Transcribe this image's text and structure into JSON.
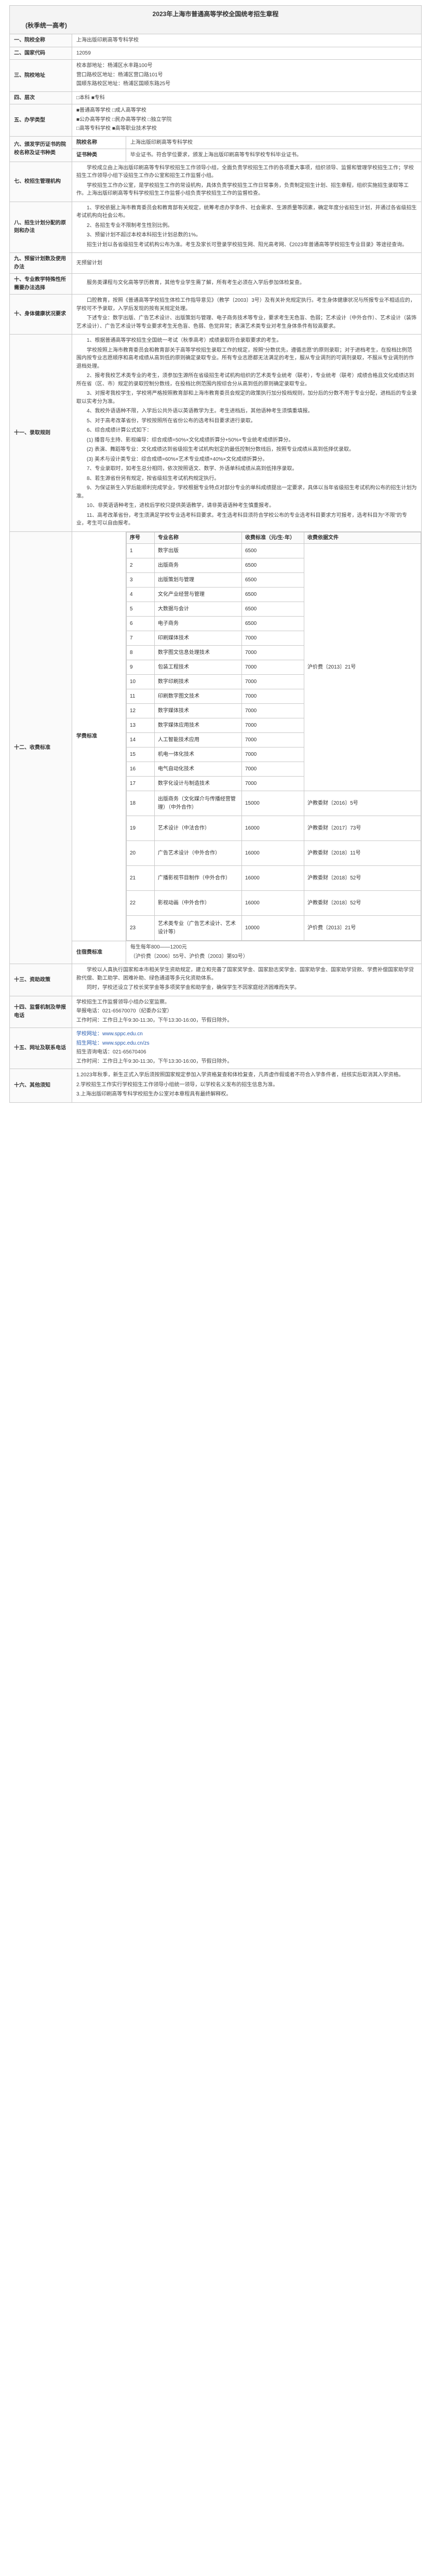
{
  "document": {
    "title": "2023年上海市普通高等学校全国统考招生章程",
    "subtitle": "(秋季统一高考)"
  },
  "sections": {
    "s1": {
      "label": "一、院校全称",
      "text": "上海出版印刷高等专科学校"
    },
    "s2": {
      "label": "二、国家代码",
      "text": "12059"
    },
    "s3": {
      "label": "三、院校地址",
      "lines": [
        "校本部地址：杨浦区水丰路100号",
        "营口路校区地址：杨浦区营口路101号",
        "国顺东路校区地址：杨浦区国顺东路25号"
      ]
    },
    "s4": {
      "label": "四、层次",
      "text": "□本科 ■专科"
    },
    "s5": {
      "label": "五、办学类型",
      "lines": [
        "■普通高等学校 □成人高等学校",
        "■公办高等学校 □民办高等学校 □独立学院",
        "□高等专科学校 ■高等职业技术学校"
      ]
    },
    "s6": {
      "label": "六、颁发学历证书的院校名称及证书种类",
      "rows": [
        {
          "label": "院校名称",
          "text": "上海出版印刷高等专科学校"
        },
        {
          "label": "证书种类",
          "text": "毕业证书。符合学位要求，颁发上海出版印刷高等专科学校专科毕业证书。"
        }
      ]
    },
    "s7": {
      "label": "七、校招生管理机构",
      "paras": [
        "学校成立由上海出版印刷高等专科学校招生工作领导小组，全面负责学校招生工作的各项重大事项，组织领导、监督和管理学校招生工作；学校招生工作领导小组下设招生工作办公室和招生工作监督小组。",
        "学校招生工作办公室，是学校招生工作的常设机构，具体负责学校招生工作日常事务，负责制定招生计划、招生章程，组织实施招生录取等工作。上海出版印刷高等专科学校招生工作监督小组负责学校招生工作的监督检查。"
      ]
    },
    "s8": {
      "label": "八、招生计划分配的原则和办法",
      "paras": [
        "1、学校依据上海市教育委员会和教育部有关规定，统筹考虑办学条件、社会需求、生源质量等因素，确定年度分省招生计划，并通过各省级招生考试机构向社会公布。",
        "2、各招生专业不限制考生性别比例。",
        "3、预留计划不超过本校本科招生计划总数的1%。",
        "招生计划以各省级招生考试机构公布为准。考生及家长可登录学校招生网、阳光高考网、《2023年普通高等学校招生专业目录》等途径查询。"
      ]
    },
    "s9": {
      "label": "九、预留计划数及使用办法",
      "text": "无预留计划"
    },
    "s10": {
      "label": "十、专业教学特殊性所需要办法选择",
      "paras": [
        "服务类课程与文化高等学历教育，其他专业学生需了解，所有考生必须在入学后参加体检复查。"
      ]
    },
    "s11": {
      "label": "十、身体健康状况要求",
      "paras": [
        "口腔教育，按照《普通高等学校招生体检工作指导意见》（教学〔2003〕3号）及有关补充规定执行。考生身体健康状况与所报专业不相适应的，学校可不予录取，入学后发现的按有关规定处理。",
        "下述专业：数字出版、广告艺术设计、出版策划与管理、电子商务技术等专业，要求考生无色盲、色弱；艺术设计（中外合作）、艺术设计（装饰艺术设计）、广告艺术设计等专业要求考生无色盲、色弱、色觉异常；表演艺术类专业对考生身体条件有较高要求。"
      ]
    },
    "s12": {
      "label": "十一、录取规则",
      "paras": [
        "1、根据普通高等学校招生全国统一考试（秋季高考）成绩录取符合录取要求的考生。",
        "学校按照上海市教育委员会和教育部关于高等学校招生录取工作的规定，按照“分数优先，遵循志愿”的原则录取；对于进档考生，在投档比例范围内按专业志愿顺序和高考成绩从高到低的原则确定录取专业。所有专业志愿都无法满足的考生，服从专业调剂的可调剂录取，不服从专业调剂的作退档处理。",
        "2、报考我校艺术类专业的考生，须参加生源所在省级招生考试机构组织的艺术类专业统考（联考），专业统考（联考）成绩合格且文化成绩达到所在省（区、市）规定的录取控制分数线，在投档比例范围内按综合分从高到低的原则确定录取专业。",
        "3、对报考我校学生，学校将严格按照教育部和上海市教育委员会规定的政策执行加分投档规则，加分后的分数不用于专业分配，进档后的专业录取以实考分为准。",
        "4、我校外语语种不限，入学后公共外语以英语教学为主。考生进档后，其他语种考生须慎重填报。",
        "5、对于高考改革省份，学校按照所在省份公布的选考科目要求进行录取。",
        "6、综合成绩计算公式如下：",
        "(1) 播音与主持、影视编导：综合成绩=50%×文化成绩折算分+50%×专业统考成绩折算分。",
        "(2) 表演、舞蹈等专业：文化成绩达到省级招生考试机构划定的最低控制分数线后，按照专业成绩从高到低择优录取。",
        "(3) 美术与设计类专业：综合成绩=60%×艺术专业成绩+40%×文化成绩折算分。",
        "7、专业录取时，如考生总分相同，依次按照语文、数学、外语单科成绩从高到低排序录取。",
        "8、若生源省份另有规定，按省级招生考试机构规定执行。",
        "9、为保证新生入学后能顺利完成学业，学校根据专业特点对部分专业的单科成绩提出一定要求，具体以当年省级招生考试机构公布的招生计划为准。",
        "10、非英语语种考生，进校后学校只提供英语教学，请非英语语种考生慎重报考。",
        "11、高考改革省份，考生须满足学校专业选考科目要求。考生选考科目须符合学校公布的专业选考科目要求方可报考，选考科目为“不限”的专业，考生可以自由报考。"
      ]
    },
    "s13": {
      "label": "十二、收费标准",
      "tuition_label": "学费标准",
      "headers": [
        "序号",
        "专业名称",
        "收费标准（元/生·年）",
        "收费依据文件"
      ],
      "fees": [
        {
          "idx": "1",
          "major": "数字出版",
          "fee": "6500"
        },
        {
          "idx": "2",
          "major": "出版商务",
          "fee": "6500"
        },
        {
          "idx": "3",
          "major": "出版策划与管理",
          "fee": "6500"
        },
        {
          "idx": "4",
          "major": "文化产业经营与管理",
          "fee": "6500"
        },
        {
          "idx": "5",
          "major": "大数据与会计",
          "fee": "6500"
        },
        {
          "idx": "6",
          "major": "电子商务",
          "fee": "6500"
        },
        {
          "idx": "7",
          "major": "印刷媒体技术",
          "fee": "7000"
        },
        {
          "idx": "8",
          "major": "数字图文信息处理技术",
          "fee": "7000"
        },
        {
          "idx": "9",
          "major": "包装工程技术",
          "fee": "7000"
        },
        {
          "idx": "10",
          "major": "数字印刷技术",
          "fee": "7000"
        },
        {
          "idx": "11",
          "major": "印刷数字图文技术",
          "fee": "7000"
        },
        {
          "idx": "12",
          "major": "数字媒体技术",
          "fee": "7000"
        },
        {
          "idx": "13",
          "major": "数字媒体应用技术",
          "fee": "7000"
        },
        {
          "idx": "14",
          "major": "人工智能技术应用",
          "fee": "7000"
        },
        {
          "idx": "15",
          "major": "机电一体化技术",
          "fee": "7000"
        },
        {
          "idx": "16",
          "major": "电气自动化技术",
          "fee": "7000"
        },
        {
          "idx": "17",
          "major": "数字化设计与制造技术",
          "fee": "7000"
        },
        {
          "idx": "18",
          "major": "出版商务（文化媒介与传播经营管理）（中外合作）",
          "fee": "15000"
        },
        {
          "idx": "19",
          "major": "艺术设计（中法合作）",
          "fee": "16000"
        },
        {
          "idx": "20",
          "major": "广告艺术设计（中外合作）",
          "fee": "16000"
        },
        {
          "idx": "21",
          "major": "广播影视节目制作（中外合作）",
          "fee": "16000"
        },
        {
          "idx": "22",
          "major": "影视动画（中外合作）",
          "fee": "16000"
        },
        {
          "idx": "23",
          "major": "艺术类专业（广告艺术设计、艺术设计等）",
          "fee": "10000"
        }
      ],
      "fee_docs": [
        {
          "rows": 17,
          "text": "沪价费〔2013〕21号"
        },
        {
          "rows": 1,
          "text": "沪教委财〔2016〕5号"
        },
        {
          "rows": 1,
          "text": "沪教委财〔2017〕73号"
        },
        {
          "rows": 1,
          "text": "沪教委财〔2018〕11号"
        },
        {
          "rows": 1,
          "text": "沪教委财〔2018〕52号"
        },
        {
          "rows": 1,
          "text": "沪教委财〔2018〕52号"
        },
        {
          "rows": 1,
          "text": "沪价费〔2013〕21号"
        }
      ],
      "dorm_label": "住宿费标准",
      "dorm_lines": [
        "每生每年800——1200元",
        "（沪价费〔2006〕55号、沪价费〔2003〕第93号）"
      ]
    },
    "s14": {
      "label": "十三、资助政策",
      "paras": [
        "学校以人真执行国家和本市相关学生资助规定，建立和完善了国家奖学金、国家励志奖学金、国家助学金、国家助学贷款、学费补偿国家助学贷款代偿、勤工助学、困难补助、绿色通道等多元化资助体系。",
        "同时，学校还设立了校长奖学金等多项奖学金和助学金，确保学生不因家庭经济困难而失学。"
      ]
    },
    "s15": {
      "label": "十四、监督机制及举报电话",
      "lines": [
        "学校招生工作监督领导小组办公室监察。",
        "举报电话：021-65670070（纪委办公室）",
        "工作时间：工作日上午9:30-11:30，下午13:30-16:00，节假日除外。"
      ]
    },
    "s16": {
      "label": "十五、网址及联系电话",
      "lines": [
        "学校网址：www.sppc.edu.cn",
        "招生网址：www.sppc.edu.cn/zs",
        "招生咨询电话：021-65670406",
        "工作时间：工作日上午9:30-11:30，下午13:30-16:00，节假日除外。"
      ]
    },
    "s17": {
      "label": "十六、其他须知",
      "paras": [
        "1.2023年秋季，新生正式入学后须按照国家规定参加入学资格复查和体检复查，凡弄虚作假或者不符合入学条件者，经核实后取消其入学资格。",
        "2.学校招生工作实行学校招生工作领导小组统一领导，以学校名义发布的招生信息为准。",
        "3.上海出版印刷高等专科学校招生办公室对本章程具有最终解释权。"
      ]
    }
  }
}
